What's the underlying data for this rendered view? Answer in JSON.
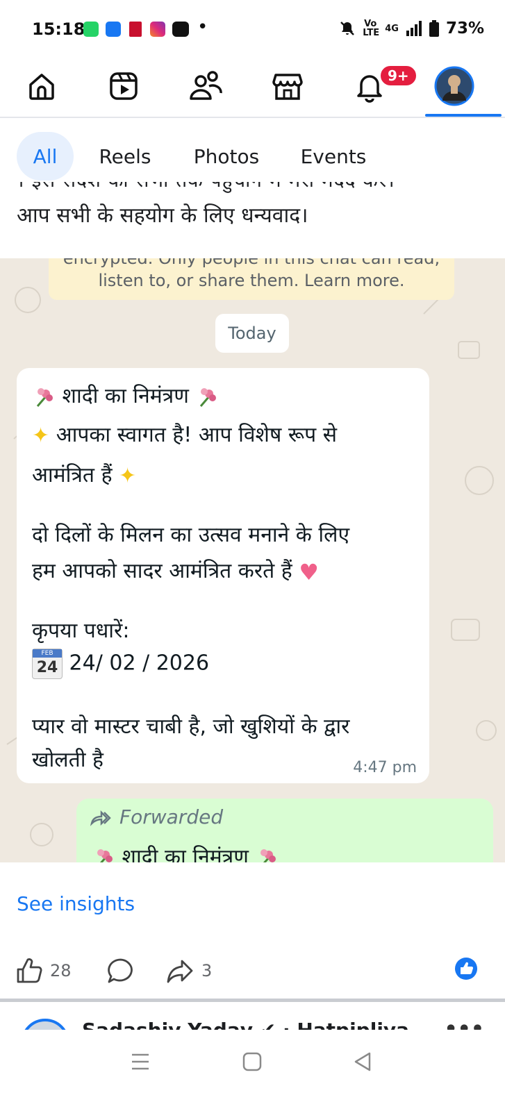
{
  "status_bar": {
    "time": "15:18",
    "battery": "73%",
    "network": "4G",
    "volte": "Vo LTE"
  },
  "nav": {
    "notifications_badge": "9+",
    "items": [
      "home-icon",
      "reels-icon",
      "friends-icon",
      "marketplace-icon",
      "notifications-icon",
      "profile-avatar"
    ]
  },
  "tabs": [
    "All",
    "Reels",
    "Photos",
    "Events"
  ],
  "post": {
    "caption_partial": "। इस संदेश को सभी तक पहुंचाने में मेरी मदद करें।",
    "caption": "आप सभी के सहयोग के लिए धन्यवाद।",
    "image": {
      "encryption_line1": "encrypted. Only people in this chat can read,",
      "encryption_line2": "listen to, or share them. Learn more.",
      "date_chip": "Today",
      "message": {
        "line1": "शादी का निमंत्रण",
        "line2": "आपका स्वागत है! आप विशेष रूप से",
        "line3": "आमंत्रित हैं",
        "line4": "दो दिलों के मिलन का उत्सव मनाने के लिए",
        "line5": "हम आपको सादर आमंत्रित करते हैं",
        "line6": "कृपया पधारें:",
        "calendar_month": "FEB",
        "calendar_day": "24",
        "date": "24/ 02 / 2026",
        "line8": "प्यार वो मास्टर चाबी है, जो खुशियों के द्वार",
        "line9": "खोलती है",
        "time": "4:47 pm"
      },
      "forwarded_label": "Forwarded",
      "forwarded_line": "शादी का निमंत्रण"
    },
    "see_insights": "See insights",
    "likes": "28",
    "shares": "3"
  },
  "next_post": {
    "author": "Sadashiv Yadav ✔ · Hatpipliya"
  },
  "colors": {
    "facebook_blue": "#1877f2",
    "badge_red": "#e41e3f",
    "chat_bg": "#efe9e0",
    "forwarded_bg": "#d9fdd3"
  }
}
